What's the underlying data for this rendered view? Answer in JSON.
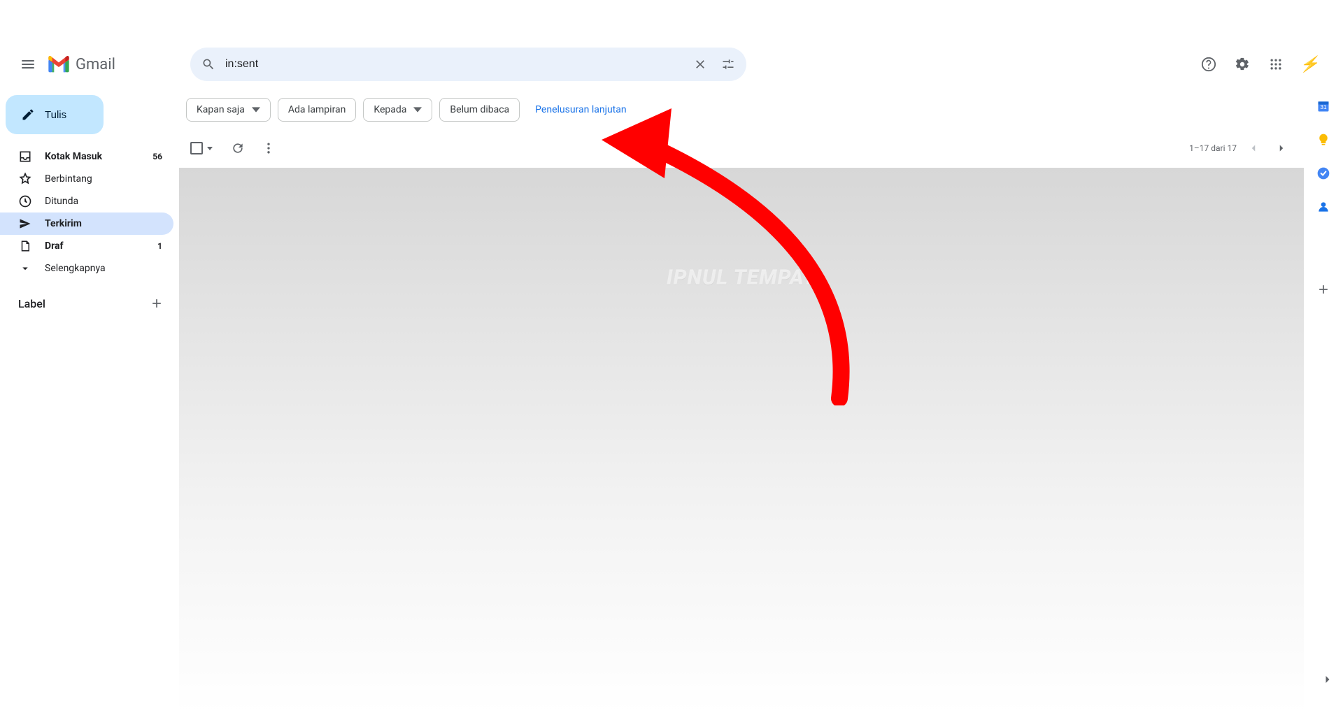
{
  "app_name": "Gmail",
  "search": {
    "value": "in:sent"
  },
  "compose_label": "Tulis",
  "sidebar": {
    "items": [
      {
        "label": "Kotak Masuk",
        "count": "56"
      },
      {
        "label": "Berbintang",
        "count": ""
      },
      {
        "label": "Ditunda",
        "count": ""
      },
      {
        "label": "Terkirim",
        "count": ""
      },
      {
        "label": "Draf",
        "count": "1"
      },
      {
        "label": "Selengkapnya",
        "count": ""
      }
    ],
    "label_section_title": "Label"
  },
  "filters": {
    "anytime": "Kapan saja",
    "has_attachment": "Ada lampiran",
    "to": "Kepada",
    "unread": "Belum dibaca",
    "advanced": "Penelusuran lanjutan"
  },
  "pagination": "1–17 dari 17",
  "watermark": "IPNUL TEMPAT"
}
